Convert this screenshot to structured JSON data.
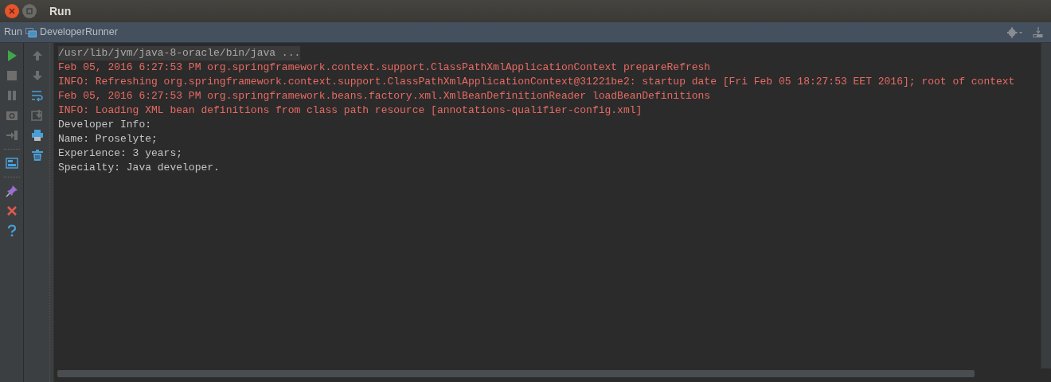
{
  "window": {
    "title": "Run"
  },
  "run_tab": {
    "label": "Run",
    "config": "DeveloperRunner"
  },
  "left_toolbar": [
    {
      "kind": "run",
      "disabled": false
    },
    {
      "kind": "stop",
      "disabled": true
    },
    {
      "kind": "pause",
      "disabled": true
    },
    {
      "kind": "camera",
      "disabled": true
    },
    {
      "kind": "exit",
      "disabled": true
    },
    {
      "kind": "separator"
    },
    {
      "kind": "layout",
      "disabled": false
    },
    {
      "kind": "separator"
    },
    {
      "kind": "pin",
      "disabled": false
    },
    {
      "kind": "close",
      "disabled": false
    },
    {
      "kind": "help",
      "disabled": false
    }
  ],
  "console_toolbar": [
    {
      "kind": "up",
      "disabled": true
    },
    {
      "kind": "down",
      "disabled": true
    },
    {
      "kind": "wrap",
      "disabled": false
    },
    {
      "kind": "scroll-end",
      "disabled": true
    },
    {
      "kind": "print",
      "disabled": false
    },
    {
      "kind": "trash",
      "disabled": false
    }
  ],
  "console": [
    {
      "text": "/usr/lib/jvm/java-8-oracle/bin/java ...",
      "kind": "command"
    },
    {
      "text": "Feb 05, 2016 6:27:53 PM org.springframework.context.support.ClassPathXmlApplicationContext prepareRefresh",
      "kind": "error"
    },
    {
      "text": "INFO: Refreshing org.springframework.context.support.ClassPathXmlApplicationContext@31221be2: startup date [Fri Feb 05 18:27:53 EET 2016]; root of context",
      "kind": "error"
    },
    {
      "text": "Feb 05, 2016 6:27:53 PM org.springframework.beans.factory.xml.XmlBeanDefinitionReader loadBeanDefinitions",
      "kind": "error"
    },
    {
      "text": "INFO: Loading XML bean definitions from class path resource [annotations-qualifier-config.xml]",
      "kind": "error"
    },
    {
      "text": "Developer Info:",
      "kind": "output"
    },
    {
      "text": "Name: Proselyte;",
      "kind": "output"
    },
    {
      "text": "Experience: 3 years;",
      "kind": "output"
    },
    {
      "text": "Specialty: Java developer.",
      "kind": "output"
    }
  ]
}
